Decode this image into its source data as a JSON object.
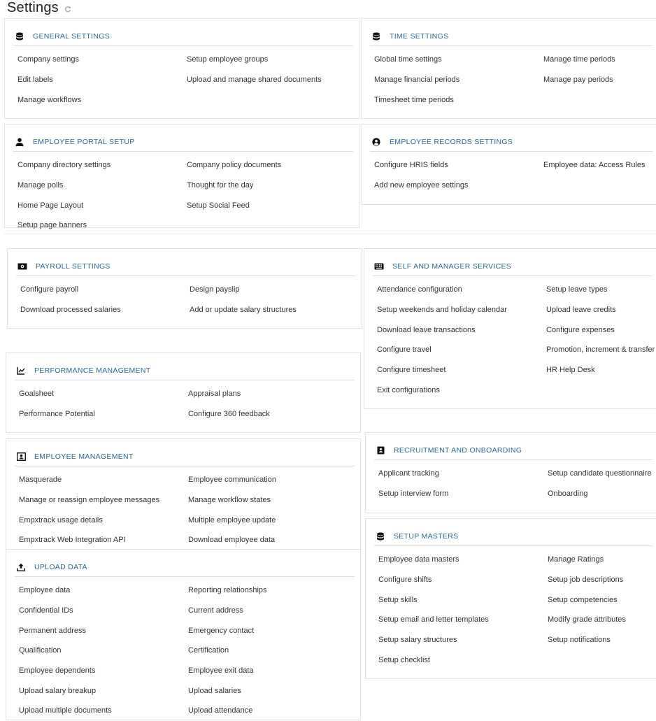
{
  "page": {
    "title": "Settings"
  },
  "sections": {
    "general": {
      "title": "GENERAL SETTINGS",
      "items": [
        "Company settings",
        "Setup employee groups",
        "Edit labels",
        "Upload and manage shared documents",
        "Manage workflows"
      ]
    },
    "time": {
      "title": "TIME SETTINGS",
      "items": [
        "Global time settings",
        "Manage time periods",
        "Manage financial periods",
        "Manage pay periods",
        "Timesheet time periods"
      ]
    },
    "portal": {
      "title": "EMPLOYEE PORTAL SETUP",
      "items": [
        "Company directory settings",
        "Company policy documents",
        "Manage polls",
        "Thought for the day",
        "Home Page Layout",
        "Setup Social Feed",
        "Setup page banners"
      ]
    },
    "records": {
      "title": "EMPLOYEE RECORDS SETTINGS",
      "items": [
        "Configure HRIS fields",
        "Employee data: Access Rules",
        "Add new employee settings"
      ]
    },
    "payroll": {
      "title": "PAYROLL SETTINGS",
      "items": [
        "Configure payroll",
        "Design payslip",
        "Download processed salaries",
        "Add or update salary structures"
      ]
    },
    "self": {
      "title": "SELF AND MANAGER SERVICES",
      "items": [
        "Attendance configuration",
        "Setup leave types",
        "Setup weekends and holiday calendar",
        "Upload leave credits",
        "Download leave transactions",
        "Configure expenses",
        "Configure travel",
        "Promotion, increment & transfer",
        "Configure timesheet",
        "HR Help Desk",
        "Exit configurations"
      ]
    },
    "performance": {
      "title": "PERFORMANCE MANAGEMENT",
      "items": [
        "Goalsheet",
        "Appraisal plans",
        "Performance Potential",
        "Configure 360 feedback"
      ]
    },
    "recruitment": {
      "title": "RECRUITMENT AND ONBOARDING",
      "items": [
        "Applicant tracking",
        "Setup candidate questionnaire",
        "Setup interview form",
        "Onboarding"
      ]
    },
    "management": {
      "title": "EMPLOYEE MANAGEMENT",
      "items": [
        "Masquerade",
        "Employee communication",
        "Manage or reassign employee messages",
        "Manage workflow states",
        "Empxtrack usage details",
        "Multiple employee update",
        "Empxtrack Web Integration API",
        "Download employee data"
      ]
    },
    "masters": {
      "title": "SETUP MASTERS",
      "items": [
        "Employee data masters",
        "Manage Ratings",
        "Configure shifts",
        "Setup job descriptions",
        "Setup skills",
        "Setup competencies",
        "Setup email and letter templates",
        "Modify grade attributes",
        "Setup salary structures",
        "Setup notifications",
        "Setup checklist"
      ]
    },
    "upload": {
      "title": "UPLOAD DATA",
      "items": [
        "Employee data",
        "Reporting relationships",
        "Confidential IDs",
        "Current address",
        "Permanent address",
        "Emergency contact",
        "Qualification",
        "Certification",
        "Employee dependents",
        "Employee exit data",
        "Upload salary breakup",
        "Upload salaries",
        "Upload multiple documents",
        "Upload attendance"
      ]
    }
  },
  "colors": {
    "title_blue": "#2a66a3",
    "text": "#333333",
    "border": "#e3e3e3"
  }
}
